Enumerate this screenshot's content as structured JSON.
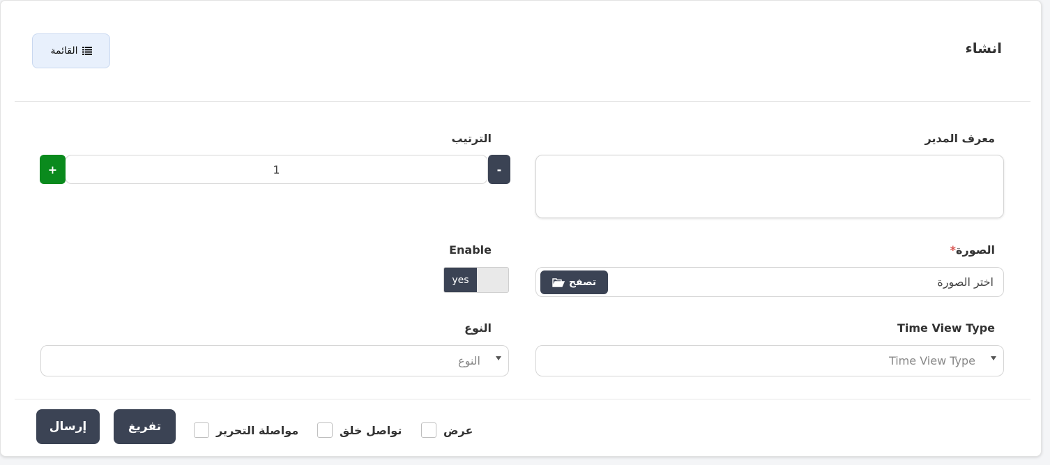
{
  "header": {
    "title": "انشاء",
    "list_button_label": "القائمة",
    "list_icon": "list-icon"
  },
  "form": {
    "admin_id": {
      "label": "معرف المدير",
      "value": ""
    },
    "order": {
      "label": "الترتيب",
      "value": "1",
      "minus": "-",
      "plus": "+"
    },
    "image": {
      "label": "الصورة",
      "required_mark": "*",
      "placeholder": "اختر الصورة",
      "browse_label": "تصفح",
      "browse_icon": "folder-open-icon"
    },
    "enable": {
      "label": "Enable",
      "value": "yes"
    },
    "time_view_type": {
      "label": "Time View Type",
      "placeholder": "Time View Type"
    },
    "type": {
      "label": "النوع",
      "placeholder": "النوع"
    }
  },
  "footer": {
    "submit_label": "إرسال",
    "reset_label": "تفريغ",
    "options": [
      {
        "label": "مواصلة التحرير",
        "checked": false
      },
      {
        "label": "تواصل خلق",
        "checked": false
      },
      {
        "label": "عرض",
        "checked": false
      }
    ]
  },
  "colors": {
    "dark_button": "#3b4354",
    "plus_button": "#0a8a1d",
    "list_button_bg": "#e8f0fc",
    "required": "#d9534f"
  }
}
